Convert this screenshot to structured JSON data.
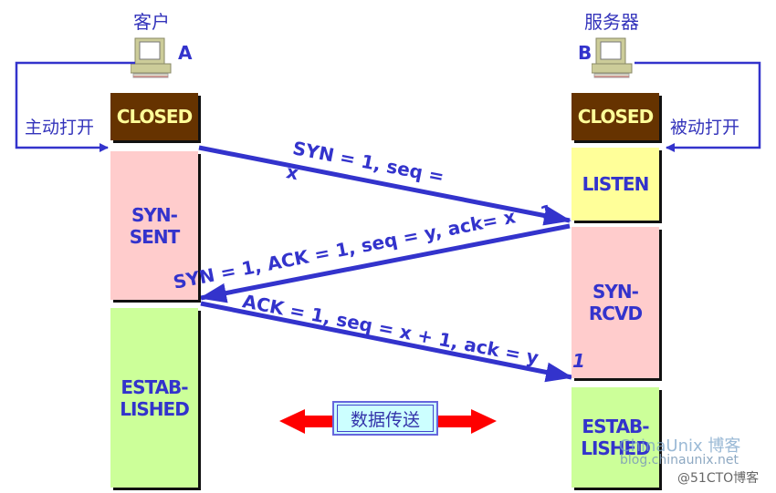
{
  "client": {
    "header": "客户",
    "letter": "A",
    "open_label": "主动打开",
    "states": [
      "CLOSED",
      "SYN-\nSENT",
      "ESTAB-\nLISHED"
    ]
  },
  "server": {
    "header": "服务器",
    "letter": "B",
    "open_label": "被动打开",
    "states": [
      "CLOSED",
      "LISTEN",
      "SYN-\nRCVD",
      "ESTAB-\nLISHED"
    ]
  },
  "messages": {
    "syn": "SYN = 1, seq =",
    "syn_tail": "x",
    "syn_ack": "SYN = 1, ACK = 1, seq = y, ack= x",
    "syn_ack_tail": "1",
    "ack": "ACK = 1, seq = x + 1, ack = y",
    "ack_tail": "1"
  },
  "data_transfer": "数据传送",
  "watermarks": {
    "chinaunix": "ChinaUnix 博客",
    "chinaunix_url": "blog.chinaunix.net",
    "cto": "@51CTO博客"
  },
  "colors": {
    "arrow": "#3333cc",
    "closed_bg": "#663300",
    "closed_text": "#ffff99",
    "syn_bg": "#ffcccc",
    "established_bg": "#ccff99",
    "listen_bg": "#ffff99",
    "data_arrow": "#ff0000"
  }
}
